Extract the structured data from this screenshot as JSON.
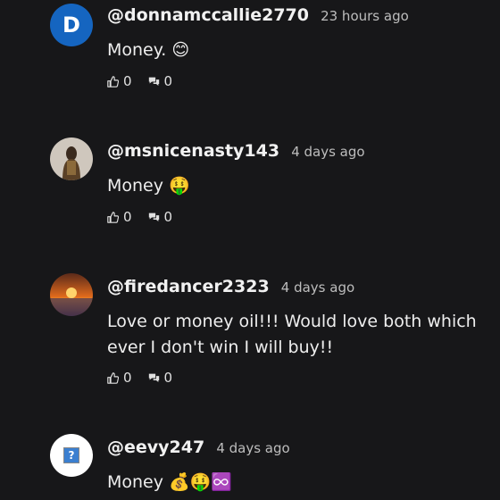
{
  "comments": [
    {
      "avatar_letter": "D",
      "username": "@donnamccallie2770",
      "time": "23 hours ago",
      "text": "Money. 😊",
      "likes": "0",
      "replies": "0"
    },
    {
      "username": "@msnicenasty143",
      "time": "4 days ago",
      "text": "Money 🤑",
      "likes": "0",
      "replies": "0"
    },
    {
      "username": "@firedancer2323",
      "time": "4 days ago",
      "text": "Love or money oil!!! Would love both which ever I don't win I will buy!!",
      "likes": "0",
      "replies": "0"
    },
    {
      "avatar_glyph": "?",
      "username": "@eevy247",
      "time": "4 days ago",
      "text": "Money 💰🤑♾️"
    }
  ]
}
